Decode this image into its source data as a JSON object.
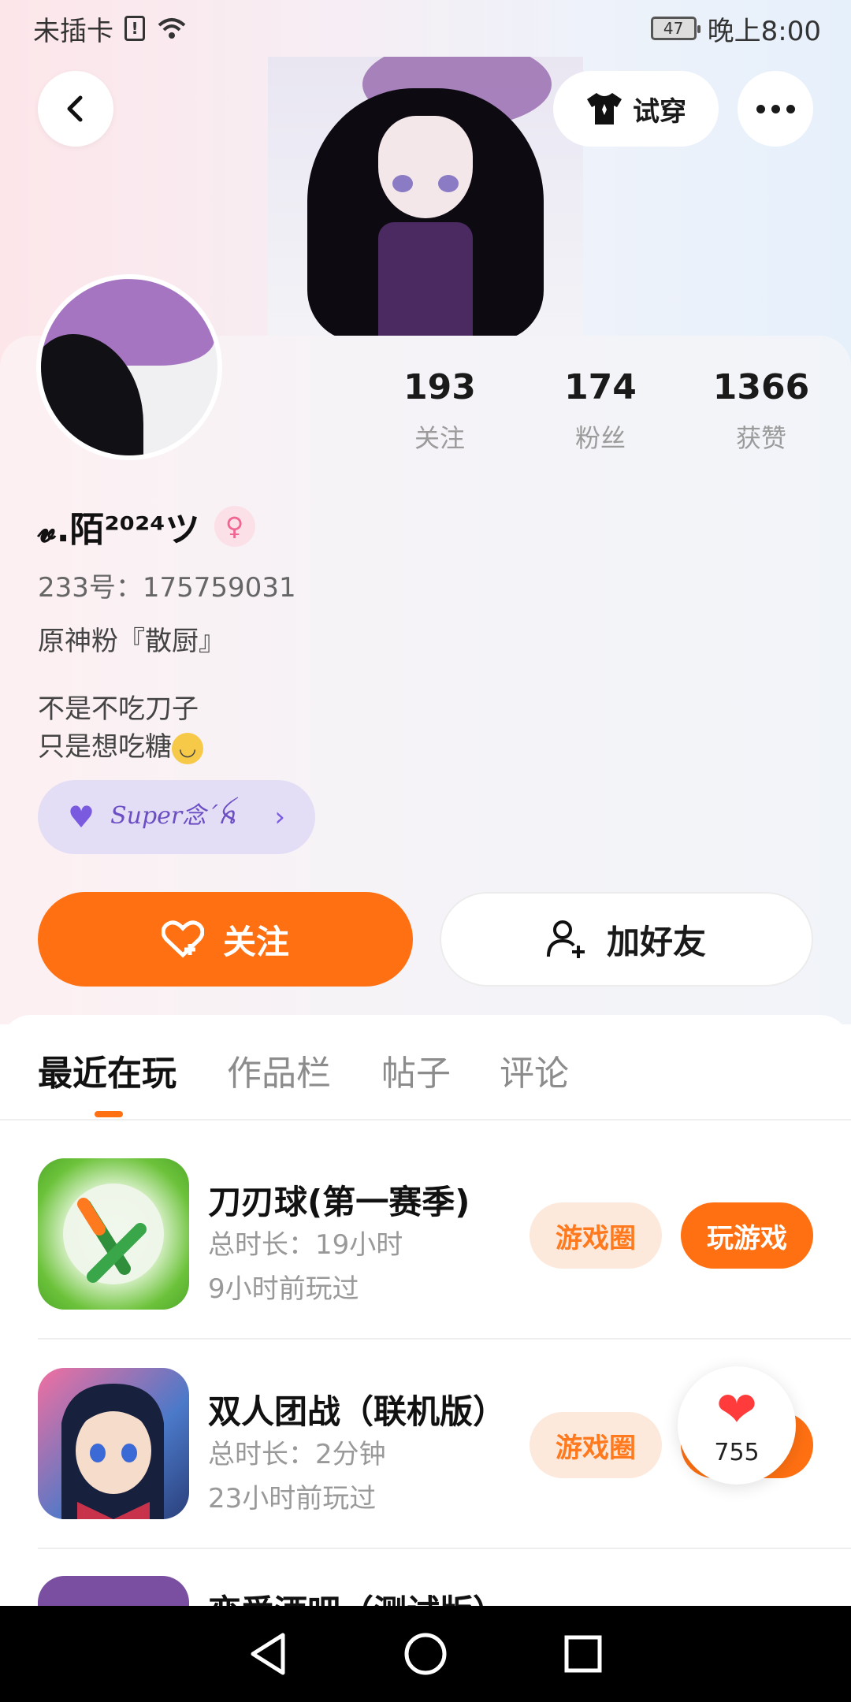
{
  "status_bar": {
    "carrier": "未插卡",
    "battery": "47",
    "time": "晚上8:00"
  },
  "header": {
    "try_on_label": "试穿"
  },
  "profile": {
    "stats": [
      {
        "num": "193",
        "label": "关注"
      },
      {
        "num": "174",
        "label": "粉丝"
      },
      {
        "num": "1366",
        "label": "获赞"
      }
    ],
    "nickname": "𝓿.陌²⁰²⁴ツ",
    "uid": "233号：175759031",
    "tagline": "原神粉『散厨』",
    "bio_line1": "不是不吃刀子",
    "bio_line2": "只是想吃糖",
    "fan_tag": "Super念´ꫝ"
  },
  "actions": {
    "follow_label": "关注",
    "add_friend_label": "加好友"
  },
  "tabs": [
    "最近在玩",
    "作品栏",
    "帖子",
    "评论"
  ],
  "games": [
    {
      "title": "刀刃球(第一赛季)",
      "duration": "总时长：19小时",
      "last_played": "9小时前玩过",
      "circle_label": "游戏圈",
      "play_label": "玩游戏"
    },
    {
      "title": "双人团战（联机版）",
      "duration": "总时长：2分钟",
      "last_played": "23小时前玩过",
      "circle_label": "游戏圈",
      "play_label": "玩游戏"
    },
    {
      "title": "恋爱酒吧（测试版）"
    }
  ],
  "like_float": {
    "count": "755"
  },
  "colors": {
    "accent": "#ff7012",
    "fan_tag_bg": "#e3def5",
    "circle_btn_bg": "#fde9dc"
  }
}
